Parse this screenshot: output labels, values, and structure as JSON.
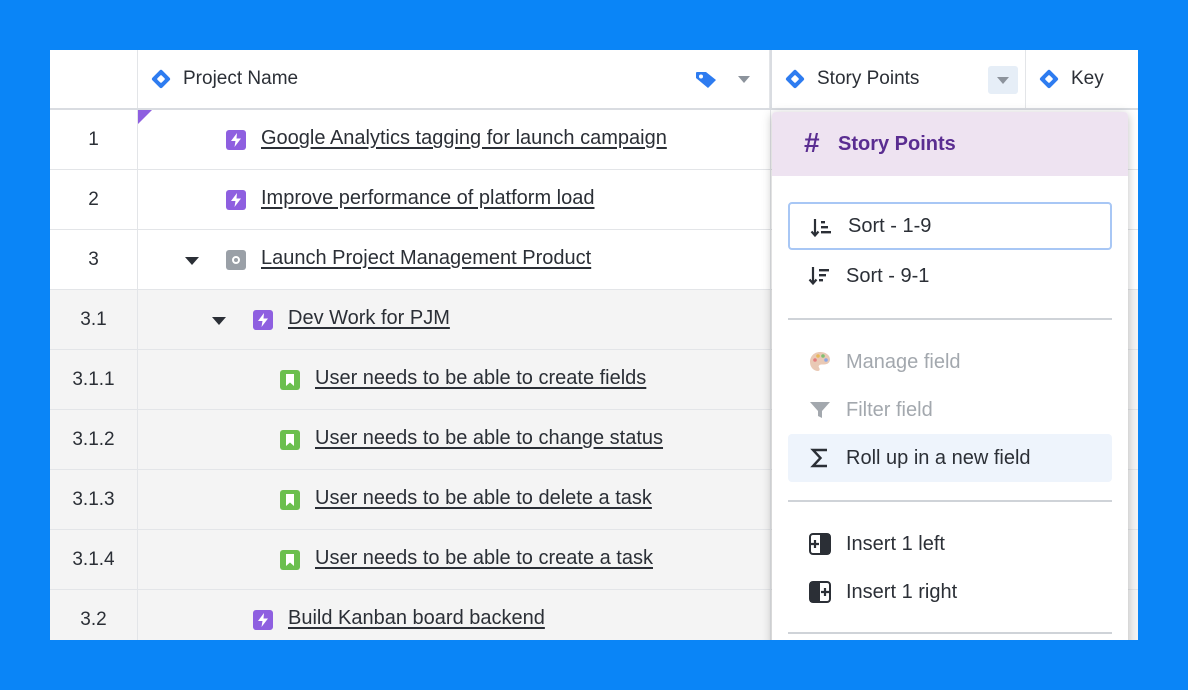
{
  "header": {
    "project_name": "Project Name",
    "story_points": "Story Points",
    "key": "Key"
  },
  "rows": [
    {
      "num": "1",
      "title": "Google Analytics tagging for launch campaign",
      "type": "purple"
    },
    {
      "num": "2",
      "title": "Improve performance of platform load",
      "type": "purple"
    },
    {
      "num": "3",
      "title": "Launch Project Management Product",
      "type": "gray"
    },
    {
      "num": "3.1",
      "title": "Dev Work for PJM",
      "type": "purple"
    },
    {
      "num": "3.1.1",
      "title": "User needs to be able to create fields",
      "type": "green"
    },
    {
      "num": "3.1.2",
      "title": "User needs to be able to change status",
      "type": "green"
    },
    {
      "num": "3.1.3",
      "title": "User needs to be able to delete a task",
      "type": "green"
    },
    {
      "num": "3.1.4",
      "title": "User needs to be able to create a task",
      "type": "green"
    },
    {
      "num": "3.2",
      "title": "Build Kanban board backend",
      "type": "purple"
    }
  ],
  "menu": {
    "title": "Story Points",
    "sort_asc": "Sort - 1-9",
    "sort_desc": "Sort - 9-1",
    "manage_field": "Manage field",
    "filter_field": "Filter field",
    "roll_up": "Roll up in a new field",
    "insert_left": "Insert 1 left",
    "insert_right": "Insert 1 right"
  },
  "colors": {
    "background": "#0a85f7",
    "accent_blue": "#2e7cf0",
    "purple": "#8e5fe0",
    "green": "#6bbf4e",
    "menu_header": "#eee3f1"
  }
}
